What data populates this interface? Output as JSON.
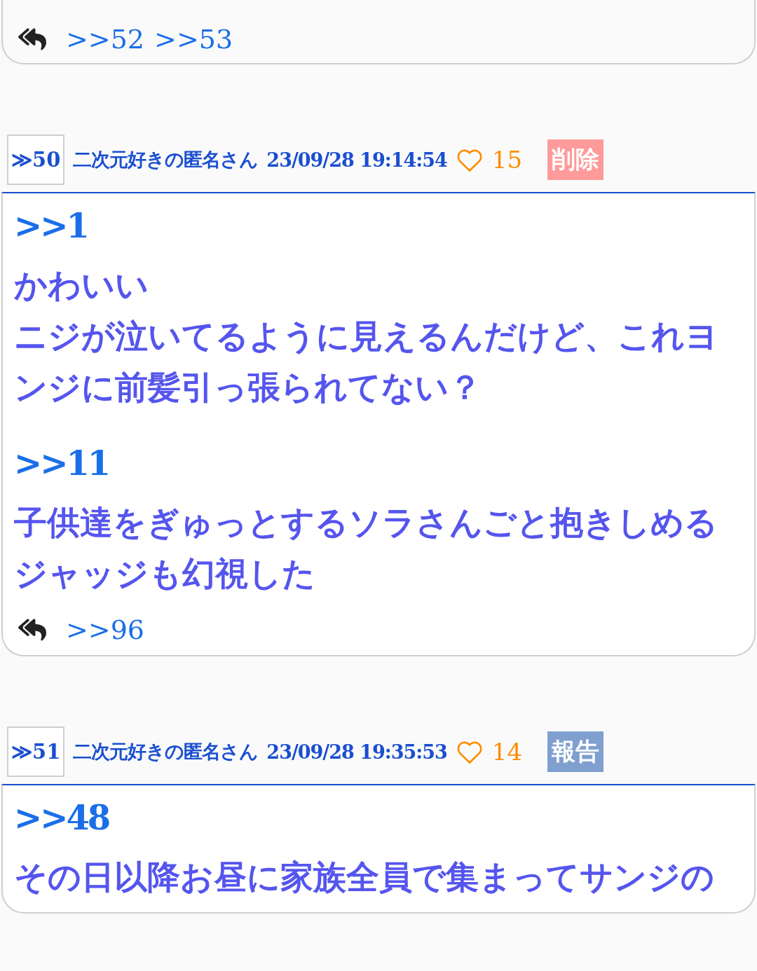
{
  "posts": [
    {
      "replies": [
        ">>52",
        ">>53"
      ]
    },
    {
      "number": "≫50",
      "author": "二次元好きの匿名さん",
      "date": "23/09/28 19:14:54",
      "likes": "15",
      "action": {
        "kind": "delete",
        "label": "削除"
      },
      "body": [
        {
          "kind": "anchor",
          "text": ">>1"
        },
        {
          "kind": "text",
          "text": "かわいい"
        },
        {
          "kind": "text",
          "text": "ニジが泣いてるように見えるんだけど、これヨンジに前髪引っ張られてない？"
        },
        {
          "kind": "blank"
        },
        {
          "kind": "anchor",
          "text": ">>11"
        },
        {
          "kind": "text",
          "text": "子供達をぎゅっとするソラさんごと抱きしめるジャッジも幻視した"
        }
      ],
      "replies": [
        ">>96"
      ]
    },
    {
      "number": "≫51",
      "author": "二次元好きの匿名さん",
      "date": "23/09/28 19:35:53",
      "likes": "14",
      "action": {
        "kind": "report",
        "label": "報告"
      },
      "body": [
        {
          "kind": "anchor",
          "text": ">>48"
        },
        {
          "kind": "text",
          "text": "その日以降お昼に家族全員で集まってサンジの"
        }
      ]
    }
  ]
}
